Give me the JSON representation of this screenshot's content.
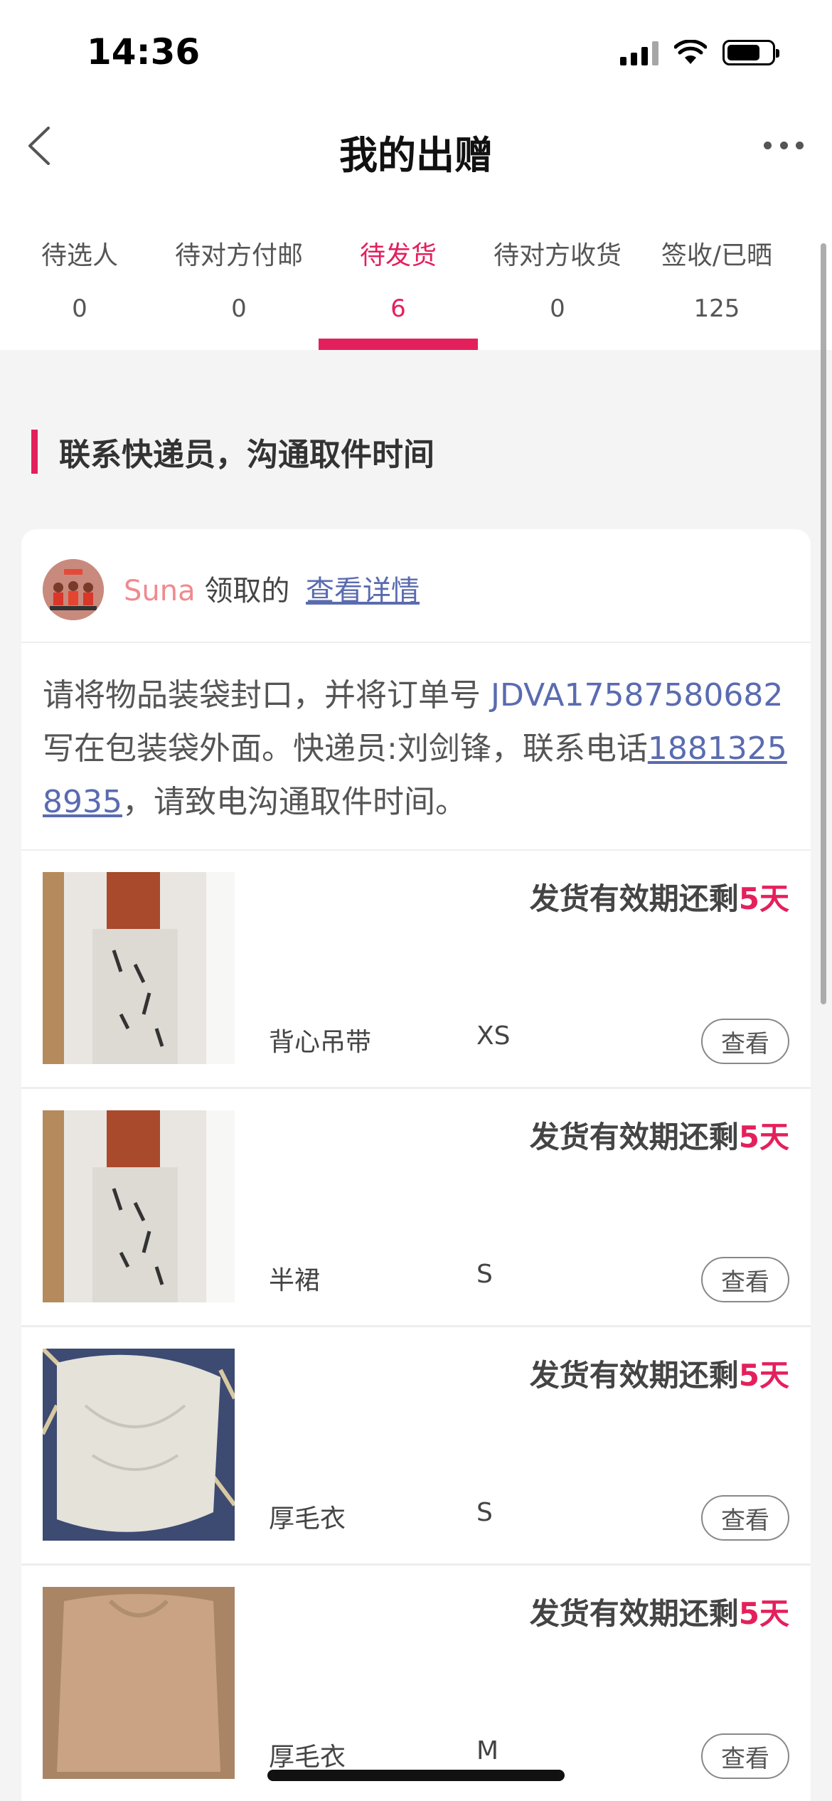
{
  "status_bar": {
    "time": "14:36"
  },
  "header": {
    "title": "我的出赠"
  },
  "tabs": [
    {
      "label": "待选人",
      "count": "0"
    },
    {
      "label": "待对方付邮",
      "count": "0"
    },
    {
      "label": "待发货",
      "count": "6"
    },
    {
      "label": "待对方收货",
      "count": "0"
    },
    {
      "label": "签收/已晒",
      "count": "125"
    }
  ],
  "active_tab_index": 2,
  "section": {
    "title": "联系快递员，沟通取件时间"
  },
  "card": {
    "claimer_name": "Suna",
    "claimed_text": " 领取的 ",
    "details_link": "查看详情",
    "notice_prefix": "请将物品装袋封口，并将订单号 ",
    "order_number": "JDVA17587580682",
    "notice_middle": " 写在包装袋外面。快递员:刘剑锋，联系电话",
    "phone": "18813258935",
    "notice_suffix": "，请致电沟通取件时间。"
  },
  "items": [
    {
      "deadline_prefix": "发货有效期还剩",
      "deadline_days": "5天",
      "name": "背心吊带",
      "size": "XS",
      "view_label": "查看"
    },
    {
      "deadline_prefix": "发货有效期还剩",
      "deadline_days": "5天",
      "name": "半裙",
      "size": "S",
      "view_label": "查看"
    },
    {
      "deadline_prefix": "发货有效期还剩",
      "deadline_days": "5天",
      "name": "厚毛衣",
      "size": "S",
      "view_label": "查看"
    },
    {
      "deadline_prefix": "发货有效期还剩",
      "deadline_days": "5天",
      "name": "厚毛衣",
      "size": "M",
      "view_label": "查看"
    }
  ],
  "colors": {
    "accent": "#e4205c",
    "link": "#5a6bb0",
    "claimer": "#f08a8f"
  }
}
